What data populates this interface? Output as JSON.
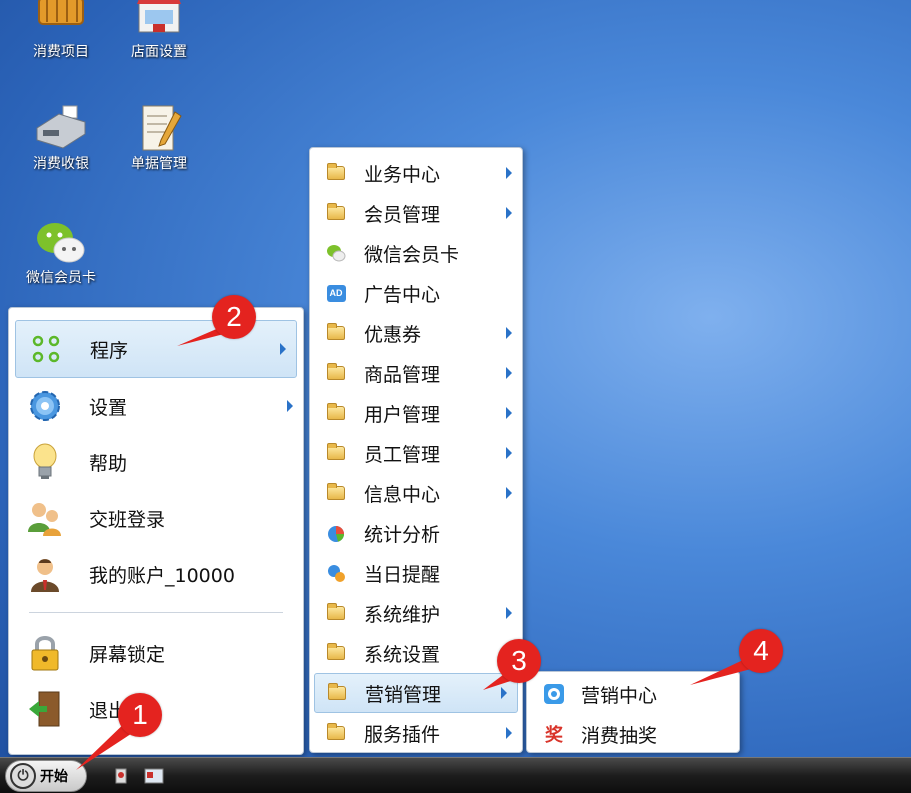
{
  "desktop": {
    "icons": [
      {
        "label": "消费项目"
      },
      {
        "label": "店面设置"
      },
      {
        "label": "消费收银"
      },
      {
        "label": "单据管理"
      },
      {
        "label": "微信会员卡"
      }
    ]
  },
  "start_menu": {
    "items": [
      {
        "label": "程序",
        "icon": "apps-grid-icon"
      },
      {
        "label": "设置",
        "icon": "gear-icon"
      },
      {
        "label": "帮助",
        "icon": "lightbulb-icon"
      },
      {
        "label": "交班登录",
        "icon": "users-icon"
      },
      {
        "label": "我的账户_10000",
        "icon": "user-icon"
      },
      {
        "label": "屏幕锁定",
        "icon": "lock-icon"
      },
      {
        "label": "退出",
        "icon": "exit-door-icon"
      }
    ]
  },
  "programs_menu": {
    "items": [
      {
        "label": "业务中心"
      },
      {
        "label": "会员管理"
      },
      {
        "label": "微信会员卡"
      },
      {
        "label": "广告中心",
        "badge": "AD"
      },
      {
        "label": "优惠券"
      },
      {
        "label": "商品管理"
      },
      {
        "label": "用户管理"
      },
      {
        "label": "员工管理"
      },
      {
        "label": "信息中心"
      },
      {
        "label": "统计分析"
      },
      {
        "label": "当日提醒"
      },
      {
        "label": "系统维护"
      },
      {
        "label": "系统设置"
      },
      {
        "label": "营销管理"
      },
      {
        "label": "服务插件"
      }
    ]
  },
  "marketing_submenu": {
    "items": [
      {
        "label": "营销中心"
      },
      {
        "label": "消费抽奖",
        "badge": "奖"
      }
    ]
  },
  "taskbar": {
    "start_label": "开始"
  },
  "markers": [
    "1",
    "2",
    "3",
    "4"
  ],
  "colors": {
    "accent": "#2a72c8",
    "marker": "#e4231f",
    "selection": "#cfe4f6"
  }
}
